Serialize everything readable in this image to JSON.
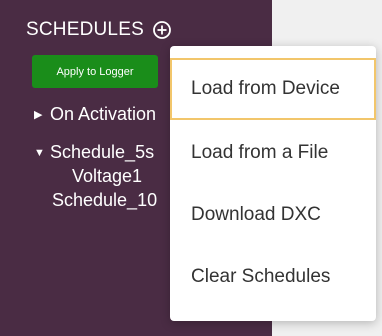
{
  "sidebar": {
    "title": "SCHEDULES",
    "apply_button": "Apply to Logger",
    "tree": [
      {
        "arrow": "▶",
        "label": "On Activation"
      },
      {
        "arrow": "▼",
        "label": "Schedule_5s"
      },
      {
        "arrow": "",
        "label": "Voltage1"
      },
      {
        "arrow": "",
        "label": "Schedule_10"
      }
    ]
  },
  "menu": {
    "items": [
      {
        "label": "Load from Device"
      },
      {
        "label": "Load from a File"
      },
      {
        "label": "Download DXC"
      },
      {
        "label": "Clear Schedules"
      }
    ]
  },
  "colors": {
    "sidebar_bg": "#4a2c44",
    "apply_button_bg": "#1a8d1a",
    "focus_border": "#f2c66b"
  }
}
